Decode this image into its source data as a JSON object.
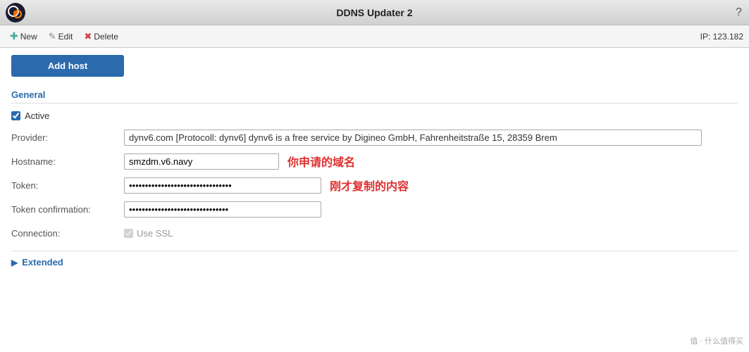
{
  "app": {
    "title": "DDNS Updater 2",
    "ip_label": "IP: 123.182",
    "help_icon": "?"
  },
  "toolbar": {
    "new_label": "New",
    "edit_label": "Edit",
    "delete_label": "Delete"
  },
  "main": {
    "add_host_button": "Add host",
    "general_section": "General",
    "active_label": "Active",
    "provider_label": "Provider:",
    "provider_value": "dynv6.com [Protocoll: dynv6] dynv6 is a free service by Digineo GmbH, Fahrenheitstraße 15, 28359 Brem",
    "hostname_label": "Hostname:",
    "hostname_value": "smzdm.v6.navy",
    "hostname_annotation": "你申请的域名",
    "token_label": "Token:",
    "token_value": "••••••••••••••••••••••••••••••••",
    "token_annotation": "刚才复制的内容",
    "token_confirm_label": "Token confirmation:",
    "token_confirm_value": "•••••••••••••••••••••••••••••••",
    "connection_label": "Connection:",
    "ssl_label": "Use SSL",
    "extended_section": "Extended"
  },
  "watermark": "值 · 什么值得买"
}
